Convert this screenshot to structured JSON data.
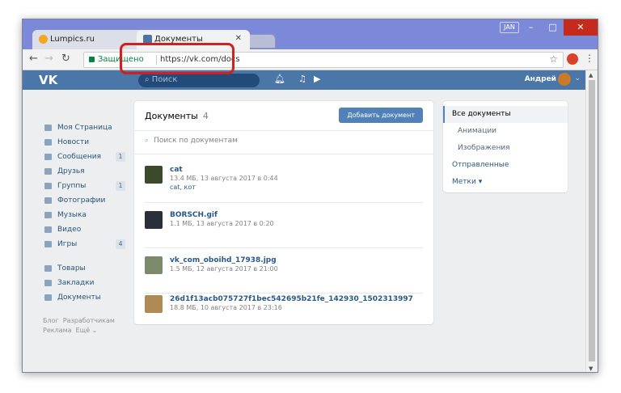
{
  "browser": {
    "tabs": [
      {
        "label": "Lumpics.ru"
      },
      {
        "label": "Документы"
      }
    ],
    "user_badge": "JAN",
    "address": {
      "secure_label": "Защищено",
      "url": "https://vk.com/docs"
    }
  },
  "vk": {
    "logo": "VK",
    "search_placeholder": "Поиск",
    "user_name": "Андрей",
    "left_menu": [
      {
        "label": "Моя Страница",
        "icon": "home-icon",
        "count": ""
      },
      {
        "label": "Новости",
        "icon": "news-icon",
        "count": ""
      },
      {
        "label": "Сообщения",
        "icon": "messages-icon",
        "count": "1"
      },
      {
        "label": "Друзья",
        "icon": "friends-icon",
        "count": ""
      },
      {
        "label": "Группы",
        "icon": "groups-icon",
        "count": "1"
      },
      {
        "label": "Фотографии",
        "icon": "photos-icon",
        "count": ""
      },
      {
        "label": "Музыка",
        "icon": "music-icon",
        "count": ""
      },
      {
        "label": "Видео",
        "icon": "video-icon",
        "count": ""
      },
      {
        "label": "Игры",
        "icon": "games-icon",
        "count": "4"
      }
    ],
    "left_menu_extra": [
      {
        "label": "Товары",
        "icon": "goods-icon"
      },
      {
        "label": "Закладки",
        "icon": "bookmarks-icon"
      },
      {
        "label": "Документы",
        "icon": "documents-icon"
      }
    ],
    "footer": {
      "blog": "Блог",
      "developers": "Разработчикам",
      "ads": "Реклама",
      "more": "Ещё"
    },
    "docs": {
      "title": "Документы",
      "count": "4",
      "add_button": "Добавить документ",
      "search_placeholder": "Поиск по документам",
      "items": [
        {
          "name": "cat",
          "meta": "13.4 МБ, 13 августа 2017 в 0:44",
          "tags": "cat, кот",
          "thumb_color": "#3b4a2a"
        },
        {
          "name": "BORSCH.gif",
          "meta": "1.1 МБ, 13 августа 2017 в 0:20",
          "tags": "",
          "thumb_color": "#2b2f3a"
        },
        {
          "name": "vk_com_oboihd_17938.jpg",
          "meta": "1.5 МБ, 12 августа 2017 в 21:00",
          "tags": "",
          "thumb_color": "#7a8a6a"
        },
        {
          "name": "26d1f13acb075727f1bec542695b21fe_142930_1502313997",
          "meta": "18.8 МБ, 10 августа 2017 в 23:16",
          "tags": "",
          "thumb_color": "#b08a55"
        }
      ]
    },
    "filter": {
      "items": [
        {
          "label": "Все документы",
          "type": "active"
        },
        {
          "label": "Анимации",
          "type": "sub"
        },
        {
          "label": "Изображения",
          "type": "sub"
        },
        {
          "label": "Отправленные",
          "type": ""
        },
        {
          "label": "Метки ▾",
          "type": ""
        }
      ]
    }
  },
  "colors": {
    "vk_blue": "#4a76a8",
    "highlight_red": "#d21f1f",
    "link": "#2a5885"
  }
}
